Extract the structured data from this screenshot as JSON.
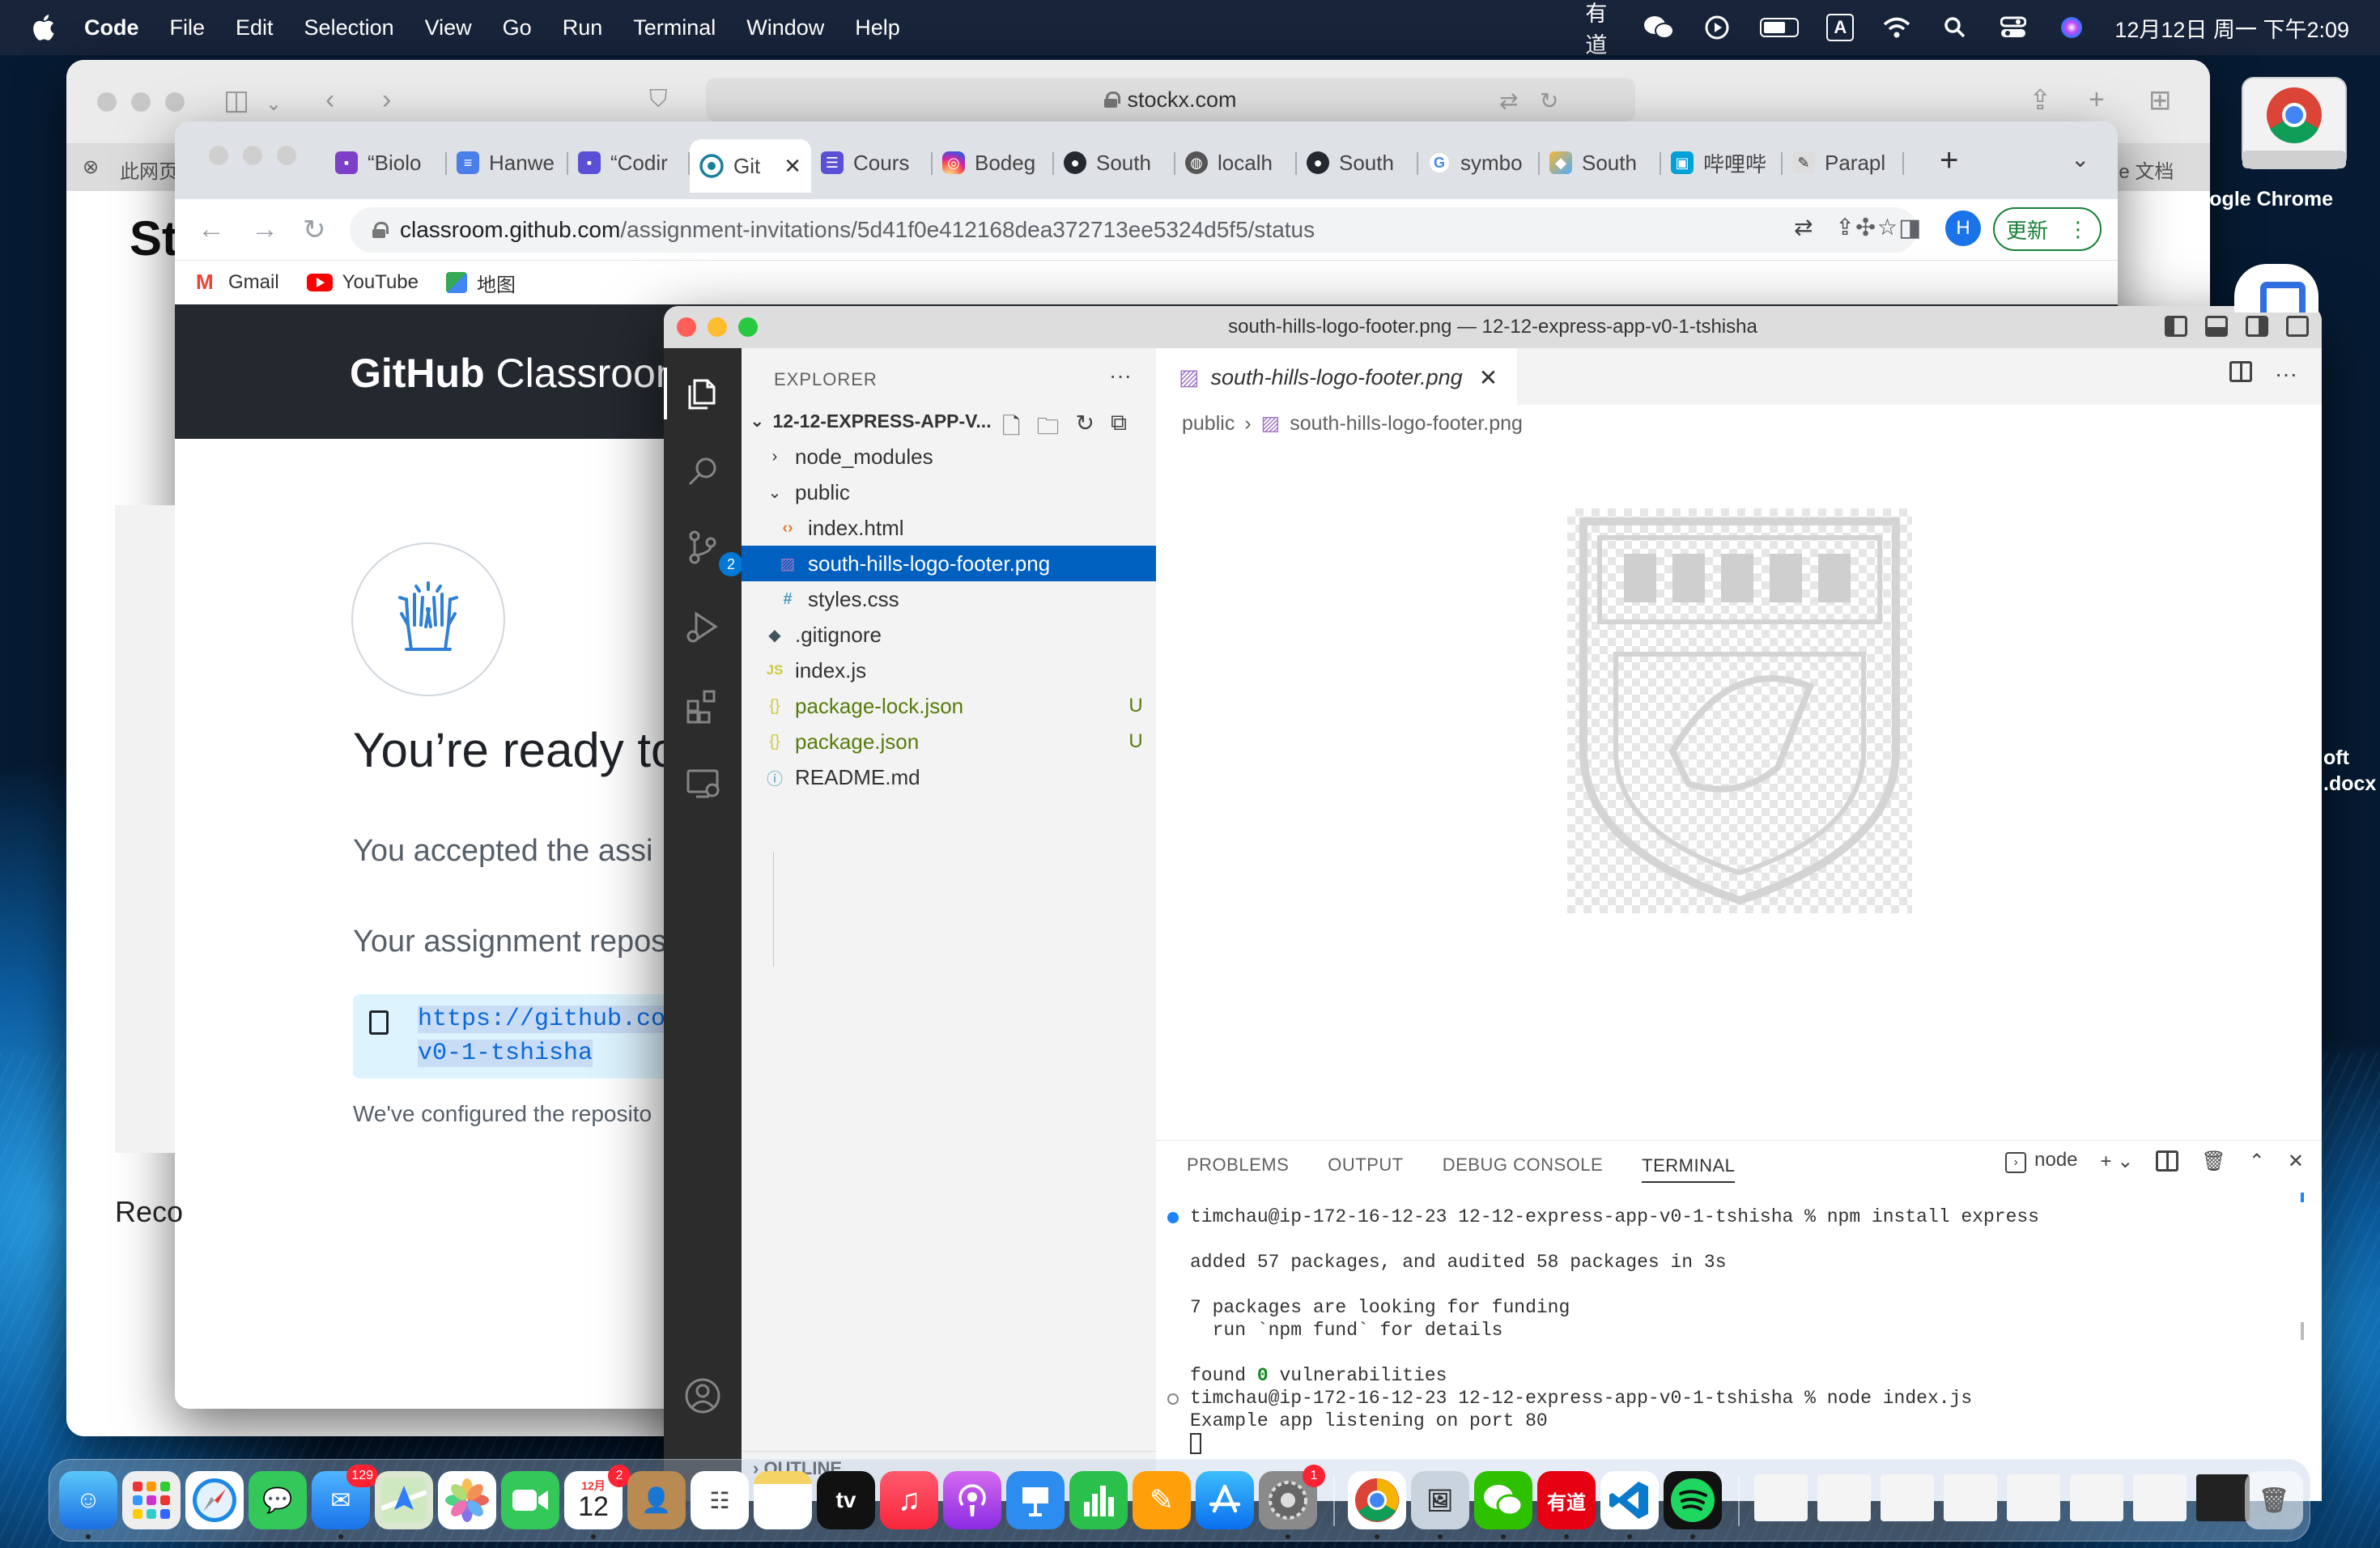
{
  "menubar": {
    "app_name": "Code",
    "menus": [
      "File",
      "Edit",
      "Selection",
      "View",
      "Go",
      "Run",
      "Terminal",
      "Window",
      "Help"
    ],
    "status_icons": [
      "youdao-icon",
      "wechat-icon",
      "play-icon",
      "battery-icon",
      "input-a-icon",
      "wifi-icon",
      "spotlight-icon",
      "control-center-icon",
      "siri-icon"
    ],
    "youdao_text": "有道",
    "input_text": "A",
    "clock": "12月12日 周一 下午2:09"
  },
  "safari": {
    "url": "stockx.com",
    "tab_left": "此网页",
    "tab_right": "le 文档",
    "page_heading_fragment": "St",
    "reco_fragment": "Reco"
  },
  "chrome": {
    "tabs": [
      {
        "label": "“Biolo",
        "icon": "contact-icon"
      },
      {
        "label": "Hanwe",
        "icon": "docs-icon"
      },
      {
        "label": "“Codir",
        "icon": "contact-icon"
      },
      {
        "label": "Git",
        "icon": "github-icon",
        "active": true
      },
      {
        "label": "Cours",
        "icon": "forms-icon"
      },
      {
        "label": "Bodeg",
        "icon": "instagram-icon"
      },
      {
        "label": "South",
        "icon": "github-icon"
      },
      {
        "label": "localh",
        "icon": "globe-icon"
      },
      {
        "label": "South",
        "icon": "github-icon"
      },
      {
        "label": "symbo",
        "icon": "google-icon"
      },
      {
        "label": "South",
        "icon": "cube-icon"
      },
      {
        "label": "哔哩哔",
        "icon": "bilibili-icon"
      },
      {
        "label": "Parapl",
        "icon": "quill-icon"
      }
    ],
    "address_host": "classroom.github.com",
    "address_path": "/assignment-invitations/5d41f0e412168dea372713ee5324d5f5/status",
    "profile_letter": "H",
    "update_label": "更新",
    "bookmarks": [
      {
        "label": "Gmail",
        "icon": "gmail-icon"
      },
      {
        "label": "YouTube",
        "icon": "youtube-icon"
      },
      {
        "label": "地图",
        "icon": "maps-icon"
      }
    ]
  },
  "github_page": {
    "logo_bold": "GitHub",
    "logo_light": "Classroom",
    "title": "You’re ready to",
    "accepted_text": "You accepted the assi",
    "repo_text": "Your assignment repos",
    "repo_link_line1": "https://github.com",
    "repo_link_line2": "v0-1-tshisha",
    "configured_text": "We've configured the reposito"
  },
  "vscode": {
    "window_title": "south-hills-logo-footer.png — 12-12-express-app-v0-1-tshisha",
    "explorer_label": "EXPLORER",
    "root_folder": "12-12-EXPRESS-APP-V...",
    "scm_badge": "2",
    "tree": [
      {
        "label": "node_modules",
        "kind": "folder-closed",
        "status": ""
      },
      {
        "label": "public",
        "kind": "folder-open",
        "status": ""
      },
      {
        "label": "index.html",
        "kind": "html",
        "status": ""
      },
      {
        "label": "south-hills-logo-footer.png",
        "kind": "png",
        "status": "",
        "selected": true
      },
      {
        "label": "styles.css",
        "kind": "css",
        "status": ""
      },
      {
        "label": ".gitignore",
        "kind": "git",
        "status": ""
      },
      {
        "label": "index.js",
        "kind": "js",
        "status": ""
      },
      {
        "label": "package-lock.json",
        "kind": "json",
        "status": "U"
      },
      {
        "label": "package.json",
        "kind": "json",
        "status": "U"
      },
      {
        "label": "README.md",
        "kind": "md",
        "status": ""
      }
    ],
    "outline_label": "OUTLINE",
    "editor_tab": "south-hills-logo-footer.png",
    "breadcrumb": [
      "public",
      "south-hills-logo-footer.png"
    ],
    "panel_tabs": [
      "PROBLEMS",
      "OUTPUT",
      "DEBUG CONSOLE",
      "TERMINAL"
    ],
    "terminal_name": "node",
    "terminal_lines": [
      {
        "text": "timchau@ip-172-16-12-23 12-12-express-app-v0-1-tshisha % npm install express",
        "marker": "blue"
      },
      {
        "text": "",
        "marker": ""
      },
      {
        "text": "added 57 packages, and audited 58 packages in 3s",
        "marker": ""
      },
      {
        "text": "",
        "marker": ""
      },
      {
        "text": "7 packages are looking for funding",
        "marker": ""
      },
      {
        "text": "  run `npm fund` for details",
        "marker": ""
      },
      {
        "text": "",
        "marker": ""
      },
      {
        "text": "found 0 vulnerabilities",
        "marker": "",
        "highlight": "0"
      },
      {
        "text": "timchau@ip-172-16-12-23 12-12-express-app-v0-1-tshisha % node index.js",
        "marker": "hollow"
      },
      {
        "text": "Example app listening on port 80",
        "marker": ""
      }
    ]
  },
  "desktop": {
    "chrome_label": "oogle Chrome",
    "docx_label_1": "oft",
    "docx_label_2": ".docx"
  },
  "dock": {
    "mail_badge": "129",
    "calendar_month": "12月",
    "calendar_day": "12",
    "calendar_badge": "2",
    "settings_badge": "1",
    "appletv_label": "tv",
    "youdao_label": "有道"
  },
  "colors": {
    "vscode_selection": "#0060c0",
    "github_header": "#24292f",
    "chrome_update_green": "#188038",
    "git_untracked": "#587c0c"
  }
}
